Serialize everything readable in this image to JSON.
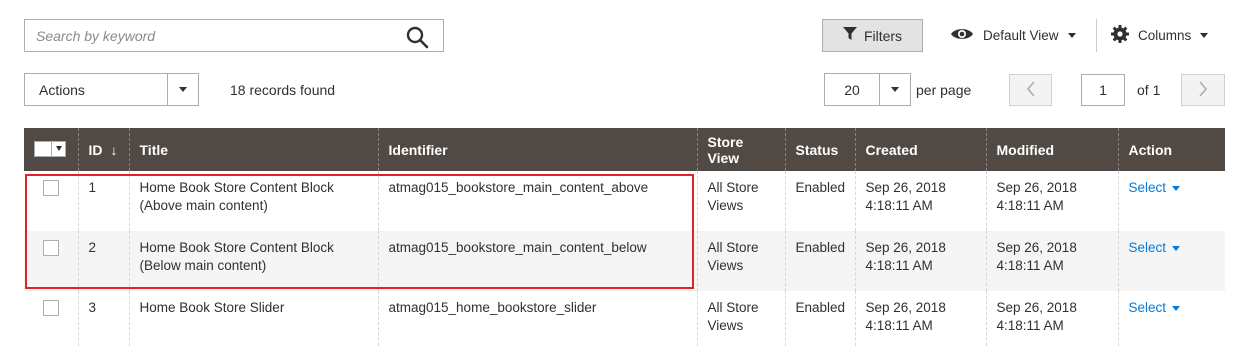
{
  "toolbar": {
    "search_placeholder": "Search by keyword",
    "filters_label": "Filters",
    "view_label": "Default View",
    "columns_label": "Columns"
  },
  "controls": {
    "actions_label": "Actions",
    "records_found": "18 records found",
    "per_page_value": "20",
    "per_page_label": "per page",
    "current_page": "1",
    "of_pages": "of 1"
  },
  "grid": {
    "columns": [
      "ID",
      "Title",
      "Identifier",
      "Store View",
      "Status",
      "Created",
      "Modified",
      "Action"
    ],
    "rows": [
      {
        "id": "1",
        "title_line1": "Home Book Store Content Block",
        "title_line2": "(Above main content)",
        "identifier": "atmag015_bookstore_main_content_above",
        "store_line1": "All Store",
        "store_line2": "Views",
        "status": "Enabled",
        "created_line1": "Sep 26, 2018",
        "created_line2": "4:18:11 AM",
        "modified_line1": "Sep 26, 2018",
        "modified_line2": "4:18:11 AM",
        "action": "Select"
      },
      {
        "id": "2",
        "title_line1": "Home Book Store Content Block",
        "title_line2": "(Below main content)",
        "identifier": "atmag015_bookstore_main_content_below",
        "store_line1": "All Store",
        "store_line2": "Views",
        "status": "Enabled",
        "created_line1": "Sep 26, 2018",
        "created_line2": "4:18:11 AM",
        "modified_line1": "Sep 26, 2018",
        "modified_line2": "4:18:11 AM",
        "action": "Select"
      },
      {
        "id": "3",
        "title_line1": "Home Book Store Slider",
        "title_line2": "",
        "identifier": "atmag015_home_bookstore_slider",
        "store_line1": "All Store",
        "store_line2": "Views",
        "status": "Enabled",
        "created_line1": "Sep 26, 2018",
        "created_line2": "4:18:11 AM",
        "modified_line1": "Sep 26, 2018",
        "modified_line2": "4:18:11 AM",
        "action": "Select"
      }
    ]
  },
  "colors": {
    "header_bg": "#514943",
    "link": "#007bdb",
    "highlight_border": "#e3202b"
  },
  "icons": {
    "search": "search-icon",
    "filter": "funnel-icon",
    "view": "eye-icon",
    "columns": "gear-icon",
    "prev": "chevron-left-icon",
    "next": "chevron-right-icon"
  }
}
